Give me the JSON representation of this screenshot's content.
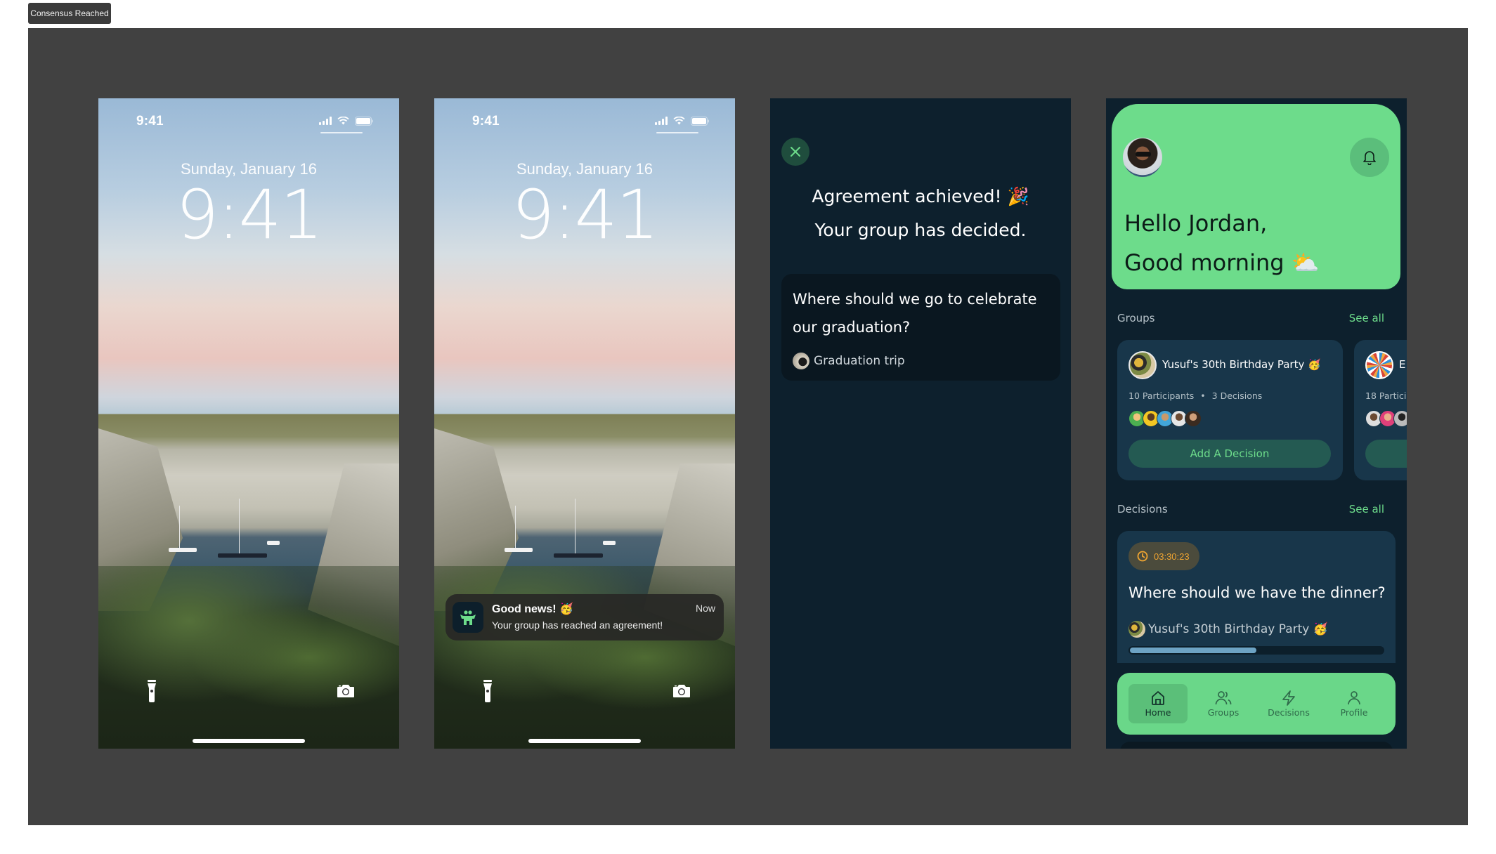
{
  "frame": {
    "label": "Consensus Reached"
  },
  "lockscreens": [
    {
      "status_time": "9:41",
      "date": "Sunday, January 16",
      "time": "9:41",
      "flashlight_icon": "flashlight-icon",
      "camera_icon": "camera-icon"
    },
    {
      "status_time": "9:41",
      "date": "Sunday, January 16",
      "time": "9:41",
      "flashlight_icon": "flashlight-icon",
      "camera_icon": "camera-icon",
      "notification": {
        "app_icon": "group-people-icon",
        "title": "Good news! 🥳",
        "body": "Your group has reached an agreement!",
        "time": "Now"
      }
    }
  ],
  "agreement": {
    "close_icon": "close-icon",
    "title_line1": "Agreement achieved! 🎉",
    "title_line2": "Your group has decided.",
    "question": "Where should we go to celebrate our graduation?",
    "group": "Graduation trip"
  },
  "home": {
    "greeting_line1": "Hello Jordan,",
    "greeting_line2": "Good morning ⛅",
    "bell_icon": "bell-icon",
    "groups_label": "Groups",
    "groups_see_all": "See all",
    "groups": [
      {
        "name": "Yusuf's 30th Birthday Party 🥳",
        "participants": "10 Participants",
        "decisions": "3 Decisions",
        "separator": "•",
        "participant_avatar_count": 5,
        "add_label": "Add A Decision"
      },
      {
        "name": "E",
        "participants": "18 Particip",
        "participant_avatar_count": 3
      }
    ],
    "decisions_label": "Decisions",
    "decisions_see_all": "See all",
    "decision": {
      "timer": "03:30:23",
      "question": "Where should we have the dinner?",
      "group": "Yusuf's 30th Birthday Party 🥳",
      "progress": 0.5
    },
    "nav": [
      {
        "label": "Home",
        "icon": "home-icon",
        "active": true
      },
      {
        "label": "Groups",
        "icon": "users-icon",
        "active": false
      },
      {
        "label": "Decisions",
        "icon": "lightning-icon",
        "active": false
      },
      {
        "label": "Profile",
        "icon": "user-icon",
        "active": false
      }
    ]
  },
  "colors": {
    "accent_green": "#6ddc8b",
    "app_bg": "#0d202d",
    "card_bg": "#18364a",
    "timer_orange": "#f0a531"
  }
}
